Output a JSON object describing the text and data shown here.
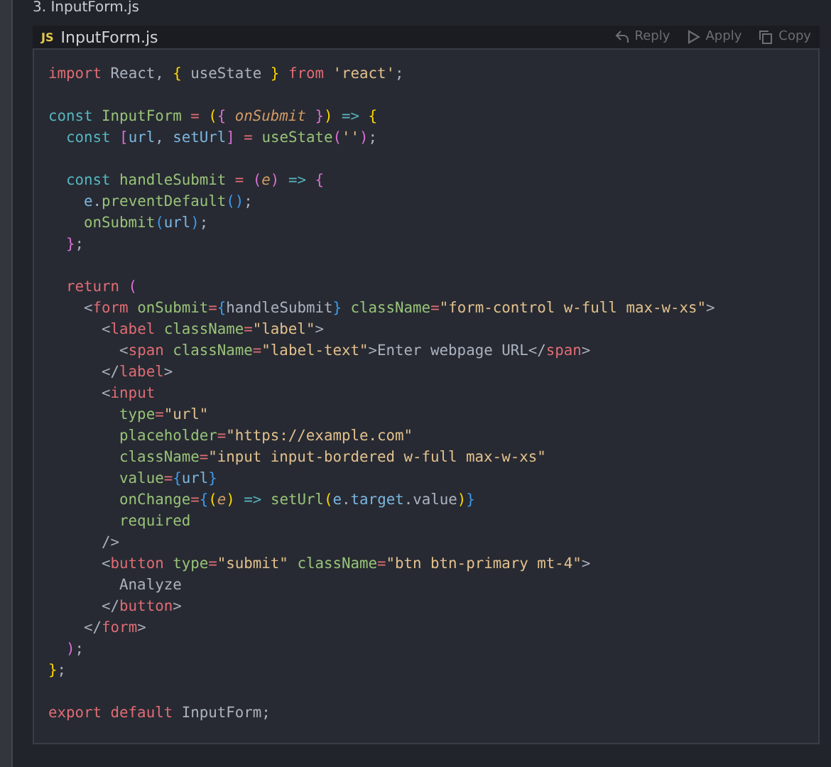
{
  "section_heading": "3. InputForm.js",
  "code_block": {
    "language_badge": "JS",
    "filename": "InputForm.js",
    "actions": [
      {
        "kind": "reply",
        "label": "Reply"
      },
      {
        "kind": "apply",
        "label": "Apply"
      },
      {
        "kind": "copy",
        "label": "Copy"
      }
    ],
    "lines": [
      {
        "kind": "code",
        "tokens": [
          {
            "kind": "kw",
            "text": "import"
          },
          {
            "kind": "plain",
            "text": " React, "
          },
          {
            "kind": "b1",
            "text": "{"
          },
          {
            "kind": "plain",
            "text": " useState "
          },
          {
            "kind": "b1",
            "text": "}"
          },
          {
            "kind": "kw",
            "text": " from"
          },
          {
            "kind": "str",
            "text": " 'react'"
          },
          {
            "kind": "plain",
            "text": ";"
          }
        ]
      },
      {
        "kind": "blank"
      },
      {
        "kind": "code",
        "tokens": [
          {
            "kind": "decl",
            "text": "const"
          },
          {
            "kind": "name",
            "text": " InputForm"
          },
          {
            "kind": "op",
            "text": " ="
          },
          {
            "kind": "b1",
            "text": " ("
          },
          {
            "kind": "b2",
            "text": "{"
          },
          {
            "kind": "param",
            "text": " onSubmit"
          },
          {
            "kind": "b2",
            "text": " }"
          },
          {
            "kind": "b1",
            "text": ")"
          },
          {
            "kind": "decl",
            "text": " =>"
          },
          {
            "kind": "b1",
            "text": " {"
          }
        ]
      },
      {
        "kind": "code",
        "tokens": [
          {
            "kind": "decl",
            "text": "  const"
          },
          {
            "kind": "b2",
            "text": " ["
          },
          {
            "kind": "var",
            "text": "url"
          },
          {
            "kind": "plain",
            "text": ","
          },
          {
            "kind": "var",
            "text": " setUrl"
          },
          {
            "kind": "b2",
            "text": "]"
          },
          {
            "kind": "op",
            "text": " ="
          },
          {
            "kind": "name",
            "text": " useState"
          },
          {
            "kind": "b2",
            "text": "("
          },
          {
            "kind": "str",
            "text": "''"
          },
          {
            "kind": "b2",
            "text": ")"
          },
          {
            "kind": "plain",
            "text": ";"
          }
        ]
      },
      {
        "kind": "blank"
      },
      {
        "kind": "code",
        "tokens": [
          {
            "kind": "decl",
            "text": "  const"
          },
          {
            "kind": "name",
            "text": " handleSubmit"
          },
          {
            "kind": "op",
            "text": " ="
          },
          {
            "kind": "b2",
            "text": " ("
          },
          {
            "kind": "param",
            "text": "e"
          },
          {
            "kind": "b2",
            "text": ")"
          },
          {
            "kind": "decl",
            "text": " =>"
          },
          {
            "kind": "b2",
            "text": " {"
          }
        ]
      },
      {
        "kind": "code",
        "tokens": [
          {
            "kind": "var",
            "text": "    e"
          },
          {
            "kind": "plain",
            "text": "."
          },
          {
            "kind": "name",
            "text": "preventDefault"
          },
          {
            "kind": "b3",
            "text": "()"
          },
          {
            "kind": "plain",
            "text": ";"
          }
        ]
      },
      {
        "kind": "code",
        "tokens": [
          {
            "kind": "name",
            "text": "    onSubmit"
          },
          {
            "kind": "b3",
            "text": "("
          },
          {
            "kind": "var",
            "text": "url"
          },
          {
            "kind": "b3",
            "text": ")"
          },
          {
            "kind": "plain",
            "text": ";"
          }
        ]
      },
      {
        "kind": "code",
        "tokens": [
          {
            "kind": "b2",
            "text": "  }"
          },
          {
            "kind": "plain",
            "text": ";"
          }
        ]
      },
      {
        "kind": "blank"
      },
      {
        "kind": "code",
        "tokens": [
          {
            "kind": "kw",
            "text": "  return"
          },
          {
            "kind": "b2",
            "text": " ("
          }
        ]
      },
      {
        "kind": "code",
        "tokens": [
          {
            "kind": "plain",
            "text": "    <"
          },
          {
            "kind": "kw",
            "text": "form"
          },
          {
            "kind": "name",
            "text": " onSubmit"
          },
          {
            "kind": "op",
            "text": "="
          },
          {
            "kind": "b3",
            "text": "{"
          },
          {
            "kind": "plain",
            "text": "handleSubmit"
          },
          {
            "kind": "b3",
            "text": "}"
          },
          {
            "kind": "name",
            "text": " className"
          },
          {
            "kind": "op",
            "text": "="
          },
          {
            "kind": "str",
            "text": "\"form-control w-full max-w-xs\""
          },
          {
            "kind": "plain",
            "text": ">"
          }
        ]
      },
      {
        "kind": "code",
        "tokens": [
          {
            "kind": "plain",
            "text": "      <"
          },
          {
            "kind": "kw",
            "text": "label"
          },
          {
            "kind": "name",
            "text": " className"
          },
          {
            "kind": "op",
            "text": "="
          },
          {
            "kind": "str",
            "text": "\"label\""
          },
          {
            "kind": "plain",
            "text": ">"
          }
        ]
      },
      {
        "kind": "code",
        "tokens": [
          {
            "kind": "plain",
            "text": "        <"
          },
          {
            "kind": "kw",
            "text": "span"
          },
          {
            "kind": "name",
            "text": " className"
          },
          {
            "kind": "op",
            "text": "="
          },
          {
            "kind": "str",
            "text": "\"label-text\""
          },
          {
            "kind": "plain",
            "text": ">Enter webpage URL</"
          },
          {
            "kind": "kw",
            "text": "span"
          },
          {
            "kind": "plain",
            "text": ">"
          }
        ]
      },
      {
        "kind": "code",
        "tokens": [
          {
            "kind": "plain",
            "text": "      </"
          },
          {
            "kind": "kw",
            "text": "label"
          },
          {
            "kind": "plain",
            "text": ">"
          }
        ]
      },
      {
        "kind": "code",
        "tokens": [
          {
            "kind": "plain",
            "text": "      <"
          },
          {
            "kind": "kw",
            "text": "input"
          }
        ]
      },
      {
        "kind": "code",
        "tokens": [
          {
            "kind": "name",
            "text": "        type"
          },
          {
            "kind": "op",
            "text": "="
          },
          {
            "kind": "str",
            "text": "\"url\""
          }
        ]
      },
      {
        "kind": "code",
        "tokens": [
          {
            "kind": "name",
            "text": "        placeholder"
          },
          {
            "kind": "op",
            "text": "="
          },
          {
            "kind": "str",
            "text": "\"https://example.com\""
          }
        ]
      },
      {
        "kind": "code",
        "tokens": [
          {
            "kind": "name",
            "text": "        className"
          },
          {
            "kind": "op",
            "text": "="
          },
          {
            "kind": "str",
            "text": "\"input input-bordered w-full max-w-xs\""
          }
        ]
      },
      {
        "kind": "code",
        "tokens": [
          {
            "kind": "name",
            "text": "        value"
          },
          {
            "kind": "op",
            "text": "="
          },
          {
            "kind": "b3",
            "text": "{"
          },
          {
            "kind": "var",
            "text": "url"
          },
          {
            "kind": "b3",
            "text": "}"
          }
        ]
      },
      {
        "kind": "code",
        "tokens": [
          {
            "kind": "name",
            "text": "        onChange"
          },
          {
            "kind": "op",
            "text": "="
          },
          {
            "kind": "b3",
            "text": "{"
          },
          {
            "kind": "b1",
            "text": "("
          },
          {
            "kind": "param",
            "text": "e"
          },
          {
            "kind": "b1",
            "text": ")"
          },
          {
            "kind": "decl",
            "text": " =>"
          },
          {
            "kind": "name",
            "text": " setUrl"
          },
          {
            "kind": "b1",
            "text": "("
          },
          {
            "kind": "var",
            "text": "e"
          },
          {
            "kind": "plain",
            "text": "."
          },
          {
            "kind": "var",
            "text": "target"
          },
          {
            "kind": "plain",
            "text": ".value"
          },
          {
            "kind": "b1",
            "text": ")"
          },
          {
            "kind": "b3",
            "text": "}"
          }
        ]
      },
      {
        "kind": "code",
        "tokens": [
          {
            "kind": "name",
            "text": "        required"
          }
        ]
      },
      {
        "kind": "code",
        "tokens": [
          {
            "kind": "plain",
            "text": "      />"
          }
        ]
      },
      {
        "kind": "code",
        "tokens": [
          {
            "kind": "plain",
            "text": "      <"
          },
          {
            "kind": "kw",
            "text": "button"
          },
          {
            "kind": "name",
            "text": " type"
          },
          {
            "kind": "op",
            "text": "="
          },
          {
            "kind": "str",
            "text": "\"submit\""
          },
          {
            "kind": "name",
            "text": " className"
          },
          {
            "kind": "op",
            "text": "="
          },
          {
            "kind": "str",
            "text": "\"btn btn-primary mt-4\""
          },
          {
            "kind": "plain",
            "text": ">"
          }
        ]
      },
      {
        "kind": "code",
        "tokens": [
          {
            "kind": "plain",
            "text": "        Analyze"
          }
        ]
      },
      {
        "kind": "code",
        "tokens": [
          {
            "kind": "plain",
            "text": "      </"
          },
          {
            "kind": "kw",
            "text": "button"
          },
          {
            "kind": "plain",
            "text": ">"
          }
        ]
      },
      {
        "kind": "code",
        "tokens": [
          {
            "kind": "plain",
            "text": "    </"
          },
          {
            "kind": "kw",
            "text": "form"
          },
          {
            "kind": "plain",
            "text": ">"
          }
        ]
      },
      {
        "kind": "code",
        "tokens": [
          {
            "kind": "b2",
            "text": "  )"
          },
          {
            "kind": "plain",
            "text": ";"
          }
        ]
      },
      {
        "kind": "code",
        "tokens": [
          {
            "kind": "b1",
            "text": "}"
          },
          {
            "kind": "plain",
            "text": ";"
          }
        ]
      },
      {
        "kind": "blank"
      },
      {
        "kind": "code",
        "tokens": [
          {
            "kind": "kw",
            "text": "export default"
          },
          {
            "kind": "plain",
            "text": " InputForm;"
          }
        ]
      }
    ]
  }
}
